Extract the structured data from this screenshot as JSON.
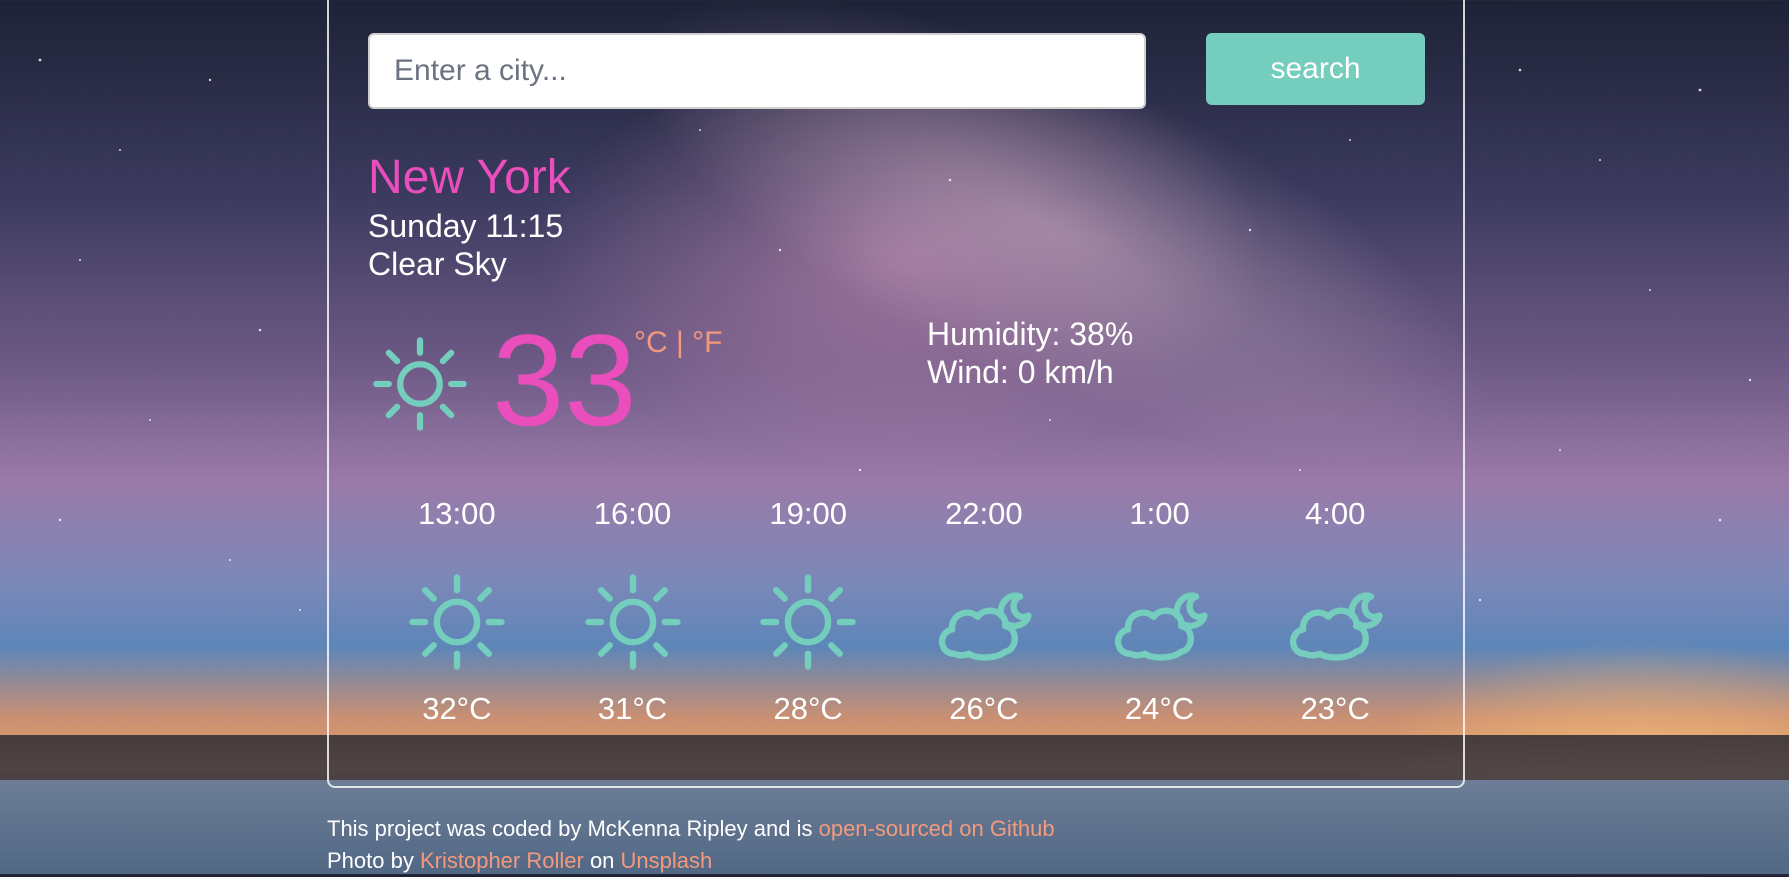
{
  "search": {
    "placeholder": "Enter a city...",
    "button_label": "search"
  },
  "current": {
    "city": "New York",
    "datetime": "Sunday 11:15",
    "description": "Clear Sky",
    "icon": "sun-icon",
    "temperature": "33",
    "unit_celsius": "°C",
    "unit_separator": "|",
    "unit_fahrenheit": "°F",
    "humidity": "Humidity: 38%",
    "wind": "Wind: 0 km/h"
  },
  "forecast": [
    {
      "time": "13:00",
      "icon": "sun-icon",
      "temp": "32°C"
    },
    {
      "time": "16:00",
      "icon": "sun-icon",
      "temp": "31°C"
    },
    {
      "time": "19:00",
      "icon": "sun-icon",
      "temp": "28°C"
    },
    {
      "time": "22:00",
      "icon": "cloudy-moon-icon",
      "temp": "26°C"
    },
    {
      "time": "1:00",
      "icon": "cloudy-moon-icon",
      "temp": "24°C"
    },
    {
      "time": "4:00",
      "icon": "cloudy-moon-icon",
      "temp": "23°C"
    }
  ],
  "footer": {
    "line1_text": "This project was coded by McKenna Ripley and is",
    "line1_link": "open-sourced on Github",
    "line2_prefix": "Photo by",
    "line2_author": "Kristopher Roller",
    "line2_mid": "on",
    "line2_site": "Unsplash"
  },
  "colors": {
    "accent_teal": "#74cdbd",
    "accent_pink": "#e94ebc",
    "accent_orange": "#f39a7d"
  }
}
